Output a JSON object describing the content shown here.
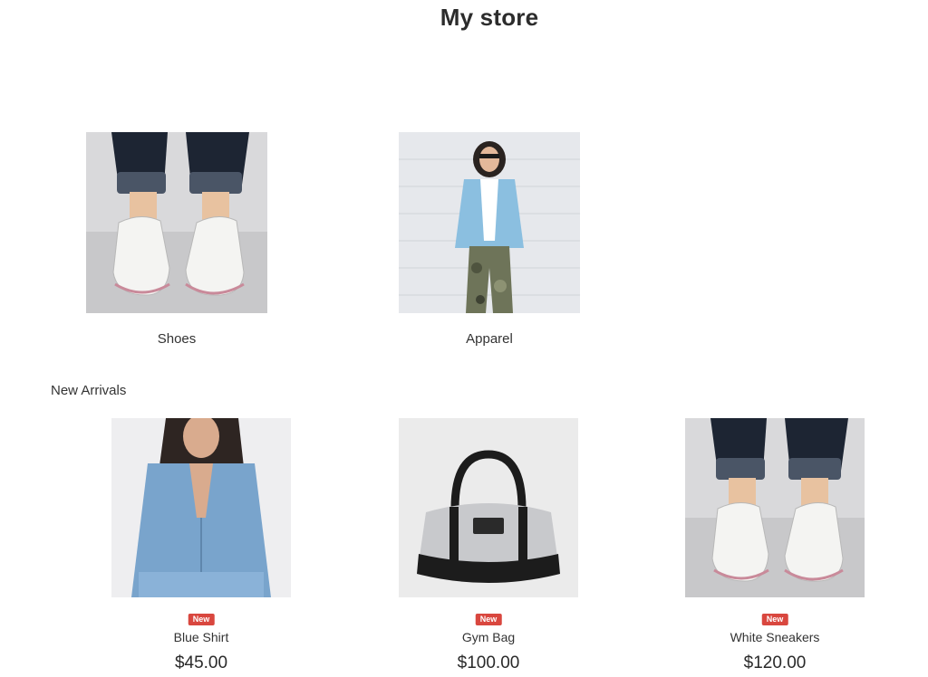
{
  "store": {
    "title": "My store"
  },
  "categories": [
    {
      "label": "Shoes",
      "image": "shoes-photo"
    },
    {
      "label": "Apparel",
      "image": "apparel-photo"
    }
  ],
  "new_arrivals": {
    "title": "New Arrivals",
    "products": [
      {
        "name": "Blue Shirt",
        "price": "$45.00",
        "badge": "New",
        "image": "blue-shirt-photo"
      },
      {
        "name": "Gym Bag",
        "price": "$100.00",
        "badge": "New",
        "image": "gym-bag-photo"
      },
      {
        "name": "White Sneakers",
        "price": "$120.00",
        "badge": "New",
        "image": "white-sneakers-photo"
      }
    ]
  },
  "colors": {
    "badge": "#d9473f",
    "text": "#2b2b2b",
    "background": "#ffffff"
  }
}
